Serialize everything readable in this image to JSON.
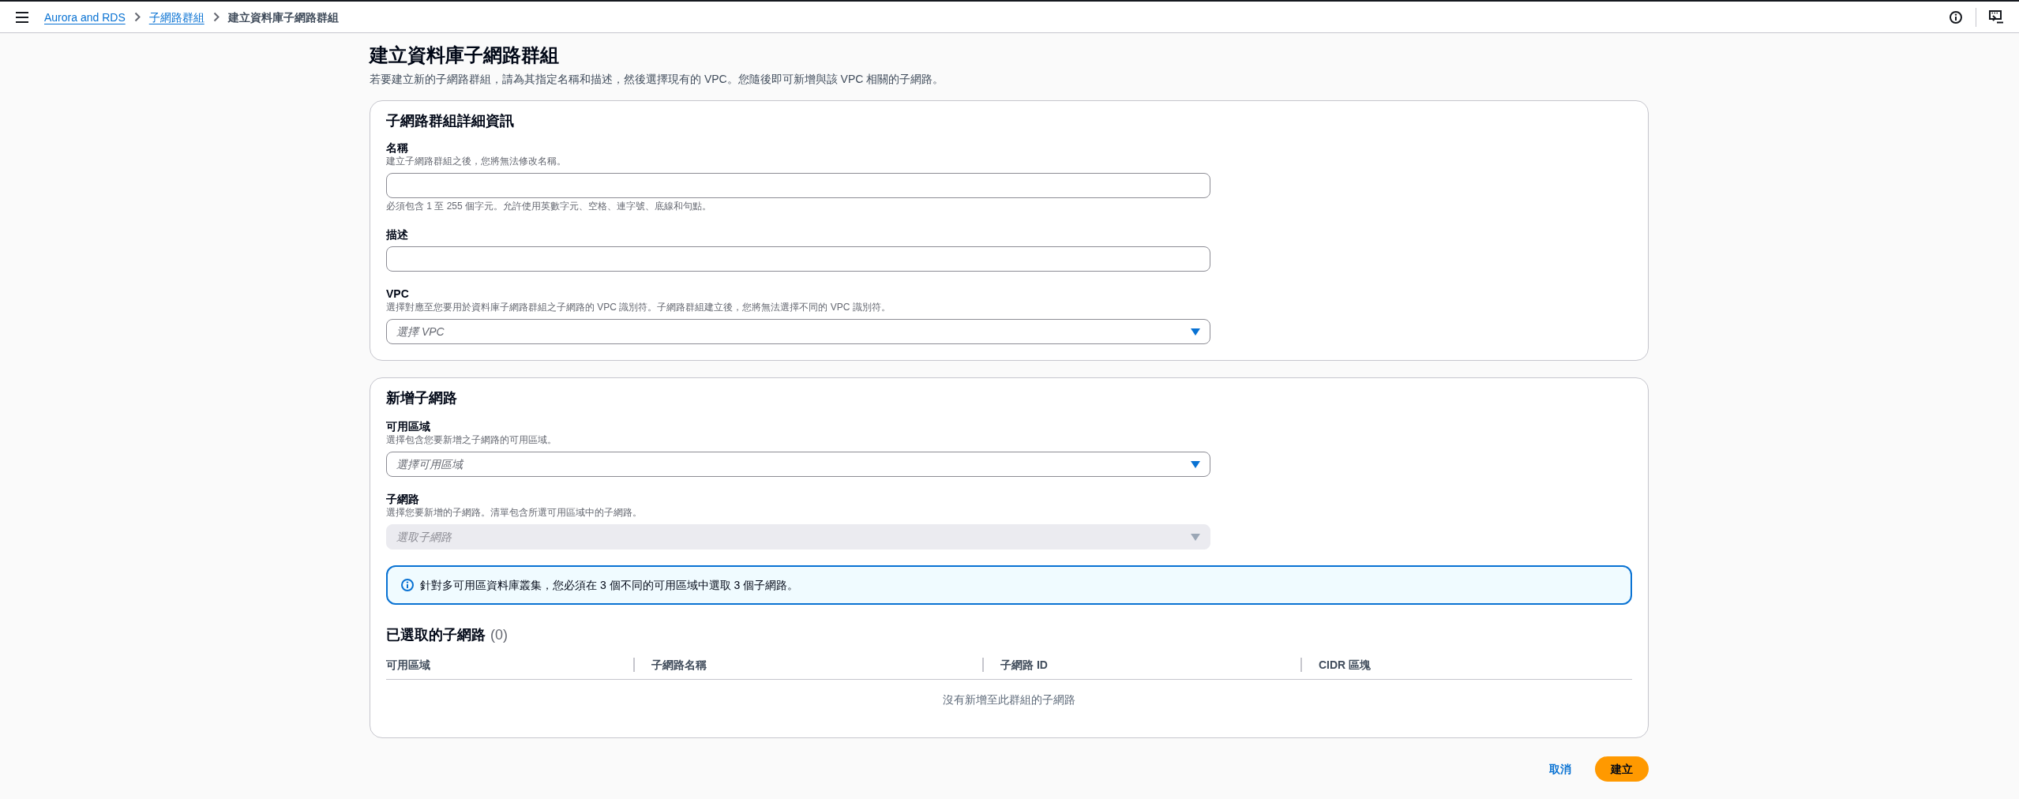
{
  "top_bar": {
    "breadcrumbs": [
      {
        "label": "Aurora and RDS",
        "current": false
      },
      {
        "label": "子網路群組",
        "current": false
      },
      {
        "label": "建立資料庫子網路群組",
        "current": true
      }
    ]
  },
  "page": {
    "title": "建立資料庫子網路群組",
    "description": "若要建立新的子網路群組，請為其指定名稱和描述，然後選擇現有的 VPC。您隨後即可新增與該 VPC 相關的子網路。"
  },
  "details_card": {
    "heading": "子網路群組詳細資訊",
    "fields": [
      {
        "kind": "text",
        "label": "名稱",
        "description": "建立子網路群組之後，您將無法修改名稱。",
        "constraint": "必須包含 1 至 255 個字元。允許使用英數字元、空格、連字號、底線和句點。",
        "disabled": false
      },
      {
        "kind": "text",
        "label": "描述",
        "disabled": false
      },
      {
        "kind": "select",
        "label": "VPC",
        "description": "選擇對應至您要用於資料庫子網路群組之子網路的 VPC 識別符。子網路群組建立後，您將無法選擇不同的 VPC 識別符。",
        "placeholder": "選擇 VPC",
        "disabled": false
      }
    ]
  },
  "add_subnets_card": {
    "heading": "新增子網路",
    "fields": [
      {
        "kind": "select",
        "label": "可用區域",
        "description": "選擇包含您要新增之子網路的可用區域。",
        "placeholder": "選擇可用區域",
        "disabled": false
      },
      {
        "kind": "select",
        "label": "子網路",
        "description": "選擇您要新增的子網路。清單包含所選可用區域中的子網路。",
        "placeholder": "選取子網路",
        "disabled": true
      }
    ],
    "alert": {
      "text": "針對多可用區資料庫叢集，您必須在 3 個不同的可用區域中選取 3 個子網路。"
    },
    "selected_subnets": {
      "heading": "已選取的子網路",
      "count": "(0)",
      "columns": [
        "可用區域",
        "子網路名稱",
        "子網路 ID",
        "CIDR 區塊"
      ],
      "empty_message": "沒有新增至此群組的子網路"
    }
  },
  "actions": [
    {
      "kind": "link",
      "label": "取消"
    },
    {
      "kind": "primary",
      "label": "建立"
    }
  ]
}
